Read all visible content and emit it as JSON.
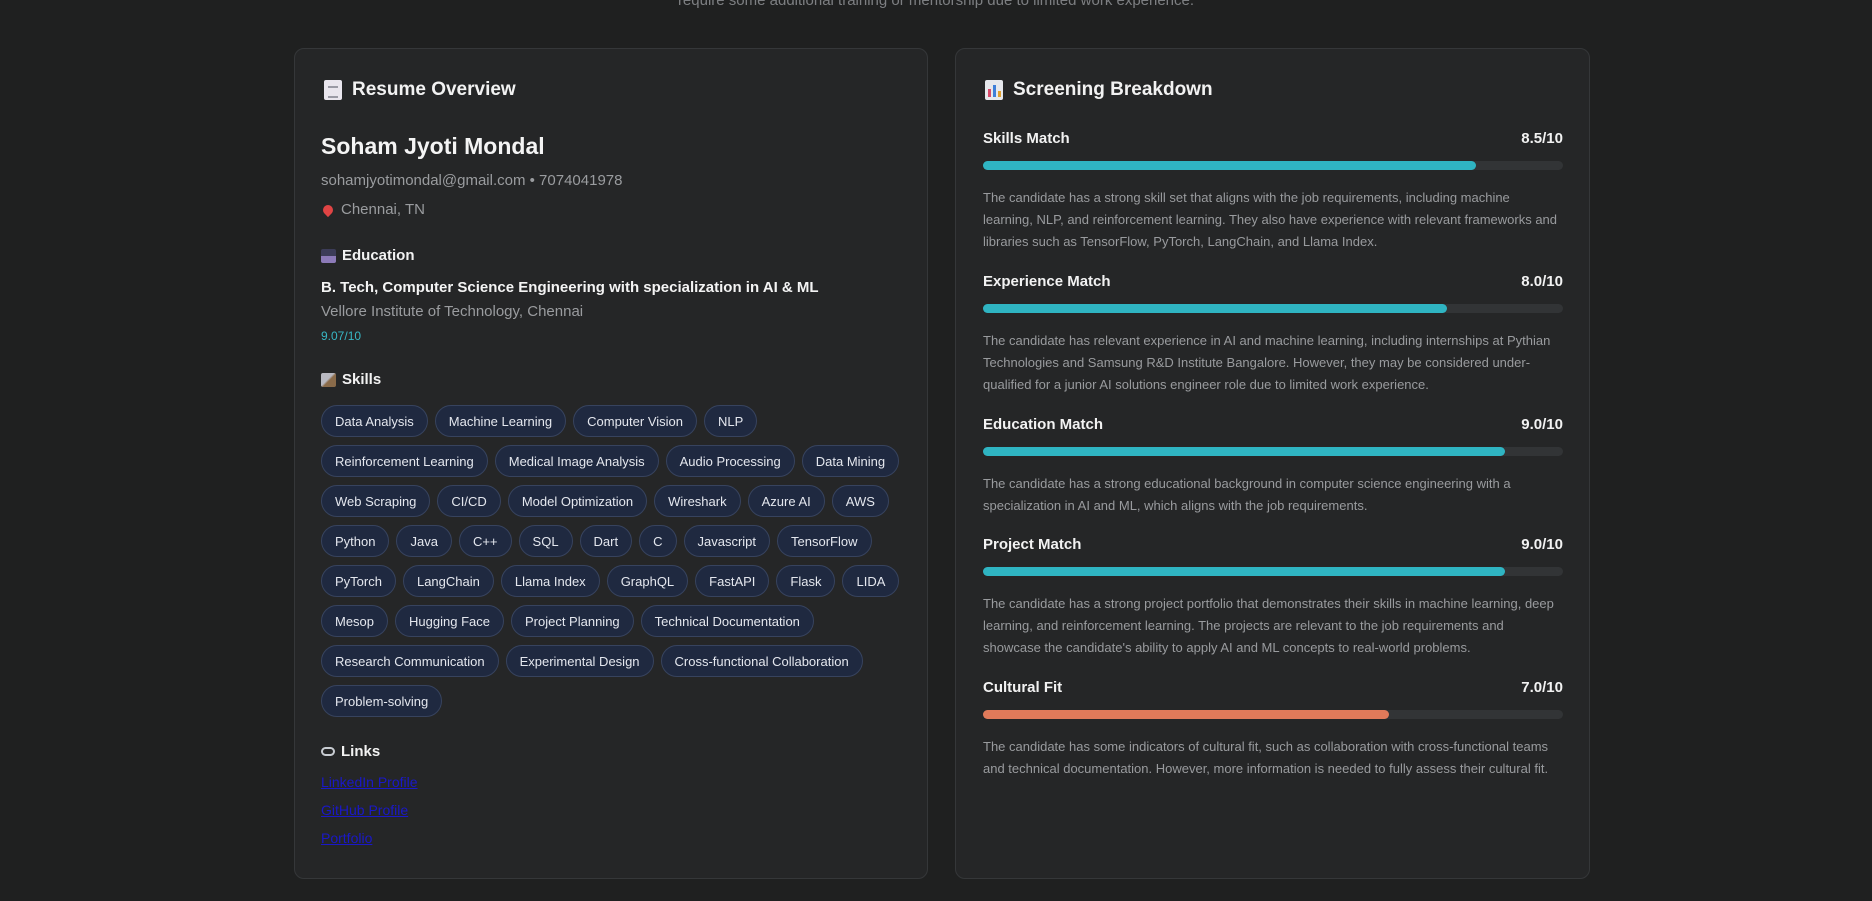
{
  "top_note": "require some additional training or mentorship due to limited work experience.",
  "resume": {
    "title": "Resume Overview",
    "name": "Soham Jyoti Mondal",
    "contact": "sohamjyotimondal@gmail.com • 7074041978",
    "location": "Chennai, TN",
    "education": {
      "heading": "Education",
      "degree": "B. Tech, Computer Science Engineering with specialization in AI & ML",
      "school": "Vellore Institute of Technology, Chennai",
      "gpa": "9.07/10"
    },
    "skills_heading": "Skills",
    "skills": [
      "Data Analysis",
      "Machine Learning",
      "Computer Vision",
      "NLP",
      "Reinforcement Learning",
      "Medical Image Analysis",
      "Audio Processing",
      "Data Mining",
      "Web Scraping",
      "CI/CD",
      "Model Optimization",
      "Wireshark",
      "Azure AI",
      "AWS",
      "Python",
      "Java",
      "C++",
      "SQL",
      "Dart",
      "C",
      "Javascript",
      "TensorFlow",
      "PyTorch",
      "LangChain",
      "Llama Index",
      "GraphQL",
      "FastAPI",
      "Flask",
      "LIDA",
      "Mesop",
      "Hugging Face",
      "Project Planning",
      "Technical Documentation",
      "Research Communication",
      "Experimental Design",
      "Cross-functional Collaboration",
      "Problem-solving"
    ],
    "links_heading": "Links",
    "links": [
      "LinkedIn Profile",
      "GitHub Profile",
      "Portfolio"
    ]
  },
  "screening": {
    "title": "Screening Breakdown",
    "metrics": [
      {
        "label": "Skills Match",
        "score_text": "8.5/10",
        "score": 8.5,
        "color": "#2fb4c2",
        "description": "The candidate has a strong skill set that aligns with the job requirements, including machine learning, NLP, and reinforcement learning. They also have experience with relevant frameworks and libraries such as TensorFlow, PyTorch, LangChain, and Llama Index."
      },
      {
        "label": "Experience Match",
        "score_text": "8.0/10",
        "score": 8.0,
        "color": "#2fb4c2",
        "description": "The candidate has relevant experience in AI and machine learning, including internships at Pythian Technologies and Samsung R&D Institute Bangalore. However, they may be considered under-qualified for a junior AI solutions engineer role due to limited work experience."
      },
      {
        "label": "Education Match",
        "score_text": "9.0/10",
        "score": 9.0,
        "color": "#2fb4c2",
        "description": "The candidate has a strong educational background in computer science engineering with a specialization in AI and ML, which aligns with the job requirements."
      },
      {
        "label": "Project Match",
        "score_text": "9.0/10",
        "score": 9.0,
        "color": "#2fb4c2",
        "description": "The candidate has a strong project portfolio that demonstrates their skills in machine learning, deep learning, and reinforcement learning. The projects are relevant to the job requirements and showcase the candidate's ability to apply AI and ML concepts to real-world problems."
      },
      {
        "label": "Cultural Fit",
        "score_text": "7.0/10",
        "score": 7.0,
        "color": "#e07a5a",
        "description": "The candidate has some indicators of cultural fit, such as collaboration with cross-functional teams and technical documentation. However, more information is needed to fully assess their cultural fit."
      }
    ]
  }
}
